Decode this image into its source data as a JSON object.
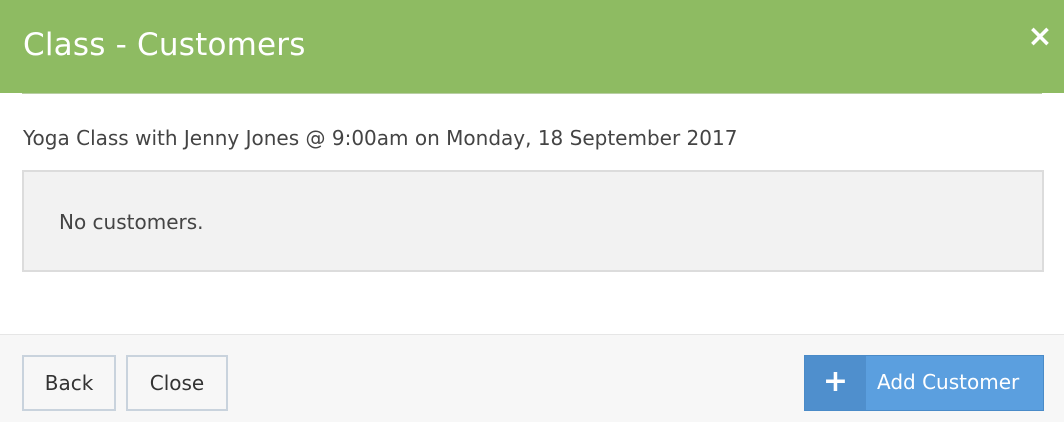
{
  "header": {
    "title": "Class - Customers",
    "close_icon": "×",
    "color": "#8ebb62"
  },
  "class_info": {
    "text": "Yoga Class with Jenny Jones @ 9:00am on Monday, 18 September 2017"
  },
  "customers": {
    "empty_text": "No customers."
  },
  "footer": {
    "back_label": "Back",
    "close_label": "Close",
    "add_icon": "+",
    "add_label": "Add Customer",
    "add_color": "#5b9fdf"
  }
}
